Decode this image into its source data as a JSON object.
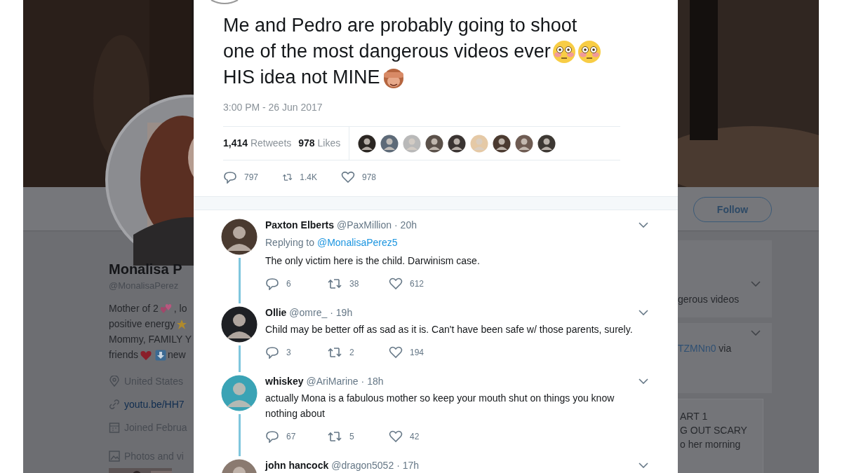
{
  "profile": {
    "name": "Monalisa P",
    "handle": "@MonalisaPerez",
    "bio": [
      {
        "kind": "text",
        "text": "Mother of 2"
      },
      {
        "kind": "hearts"
      },
      {
        "kind": "text",
        "text": ", lo"
      },
      {
        "kind": "break"
      },
      {
        "kind": "text",
        "text": "positive energy"
      },
      {
        "kind": "star"
      },
      {
        "kind": "break"
      },
      {
        "kind": "text",
        "text": "Mommy, FAMILY Y"
      },
      {
        "kind": "break"
      },
      {
        "kind": "text",
        "text": "friends"
      },
      {
        "kind": "heart"
      },
      {
        "kind": "down"
      },
      {
        "kind": "text",
        "text": "new"
      }
    ],
    "details": [
      {
        "kind": "location",
        "text": "United States"
      },
      {
        "kind": "link",
        "text": "youtu.be/HH7"
      },
      {
        "kind": "joined",
        "text": "Joined Februa"
      }
    ],
    "media_label": "Photos and vi"
  },
  "follow_button": "Follow",
  "side_cards": [
    {
      "lines": [
        {
          "text": "gerous videos"
        }
      ]
    },
    {
      "lines": [
        {
          "link": "TZMNn0",
          "text": " via"
        }
      ]
    },
    {
      "lines": [
        {
          "text": "ART 1"
        },
        {
          "text": "G OUT SCARY"
        },
        {
          "text": "o her morning"
        }
      ]
    }
  ],
  "tweet": {
    "lines": [
      [
        {
          "kind": "text",
          "text": "Me and Pedro are probably going to shoot"
        }
      ],
      [
        {
          "kind": "text",
          "text": "one of the most dangerous videos ever"
        },
        {
          "kind": "flushed"
        },
        {
          "kind": "flushed"
        }
      ],
      [
        {
          "kind": "text",
          "text": "HIS idea not MINE"
        },
        {
          "kind": "monkey"
        }
      ]
    ],
    "timestamp": "3:00 PM - 26 Jun 2017",
    "stats": [
      {
        "count": "1,414",
        "label": "Retweets"
      },
      {
        "count": "978",
        "label": "Likes"
      }
    ],
    "actions": [
      {
        "kind": "reply",
        "count": "797"
      },
      {
        "kind": "retweet",
        "count": "1.4K"
      },
      {
        "kind": "like",
        "count": "978"
      }
    ]
  },
  "replies": [
    {
      "name": "Paxton Elberts",
      "handle": "@PaxMillion",
      "time": "· 20h",
      "replying_label": "Replying to",
      "replying_to": "@MonalisaPerez5",
      "text": "The only victim here is the child. Darwinism case.",
      "actions": [
        {
          "kind": "reply",
          "count": "6"
        },
        {
          "kind": "retweet",
          "count": "38"
        },
        {
          "kind": "like",
          "count": "612"
        }
      ]
    },
    {
      "name": "Ollie",
      "handle": "@omre_",
      "time": "· 19h",
      "text": "Child may be better off as sad as it is. Can't have been safe w/ those parents, surely.",
      "actions": [
        {
          "kind": "reply",
          "count": "3"
        },
        {
          "kind": "retweet",
          "count": "2"
        },
        {
          "kind": "like",
          "count": "194"
        }
      ]
    },
    {
      "name": "whiskey",
      "handle": "@AriMarine",
      "time": "· 18h",
      "text": "actually Mona is a fabulous mother so keep your mouth shut on things you know nothing about",
      "actions": [
        {
          "kind": "reply",
          "count": "67"
        },
        {
          "kind": "retweet",
          "count": "5"
        },
        {
          "kind": "like",
          "count": "42"
        }
      ]
    },
    {
      "name": "john hancock",
      "handle": "@dragon5052",
      "time": "· 17h"
    }
  ]
}
